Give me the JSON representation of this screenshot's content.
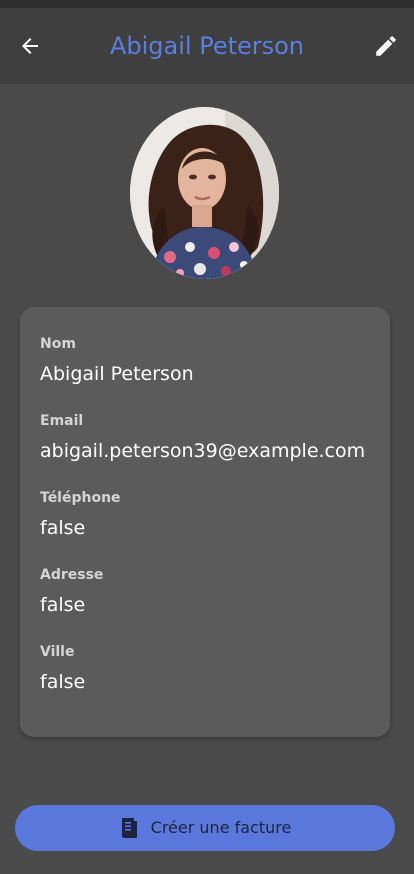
{
  "appbar": {
    "title": "Abigail Peterson",
    "back_icon": "arrow-left-icon",
    "edit_icon": "pencil-icon",
    "title_color": "#5b7fe0"
  },
  "profile": {
    "avatar": "profile-photo"
  },
  "details": {
    "name_label": "Nom",
    "name_value": "Abigail Peterson",
    "email_label": "Email",
    "email_value": "abigail.peterson39@example.com",
    "phone_label": "Téléphone",
    "phone_value": "false",
    "address_label": "Adresse",
    "address_value": "false",
    "city_label": "Ville",
    "city_value": "false"
  },
  "actions": {
    "create_invoice_label": "Créer une facture",
    "create_invoice_icon": "receipt-icon",
    "accent_color": "#5a78db"
  }
}
